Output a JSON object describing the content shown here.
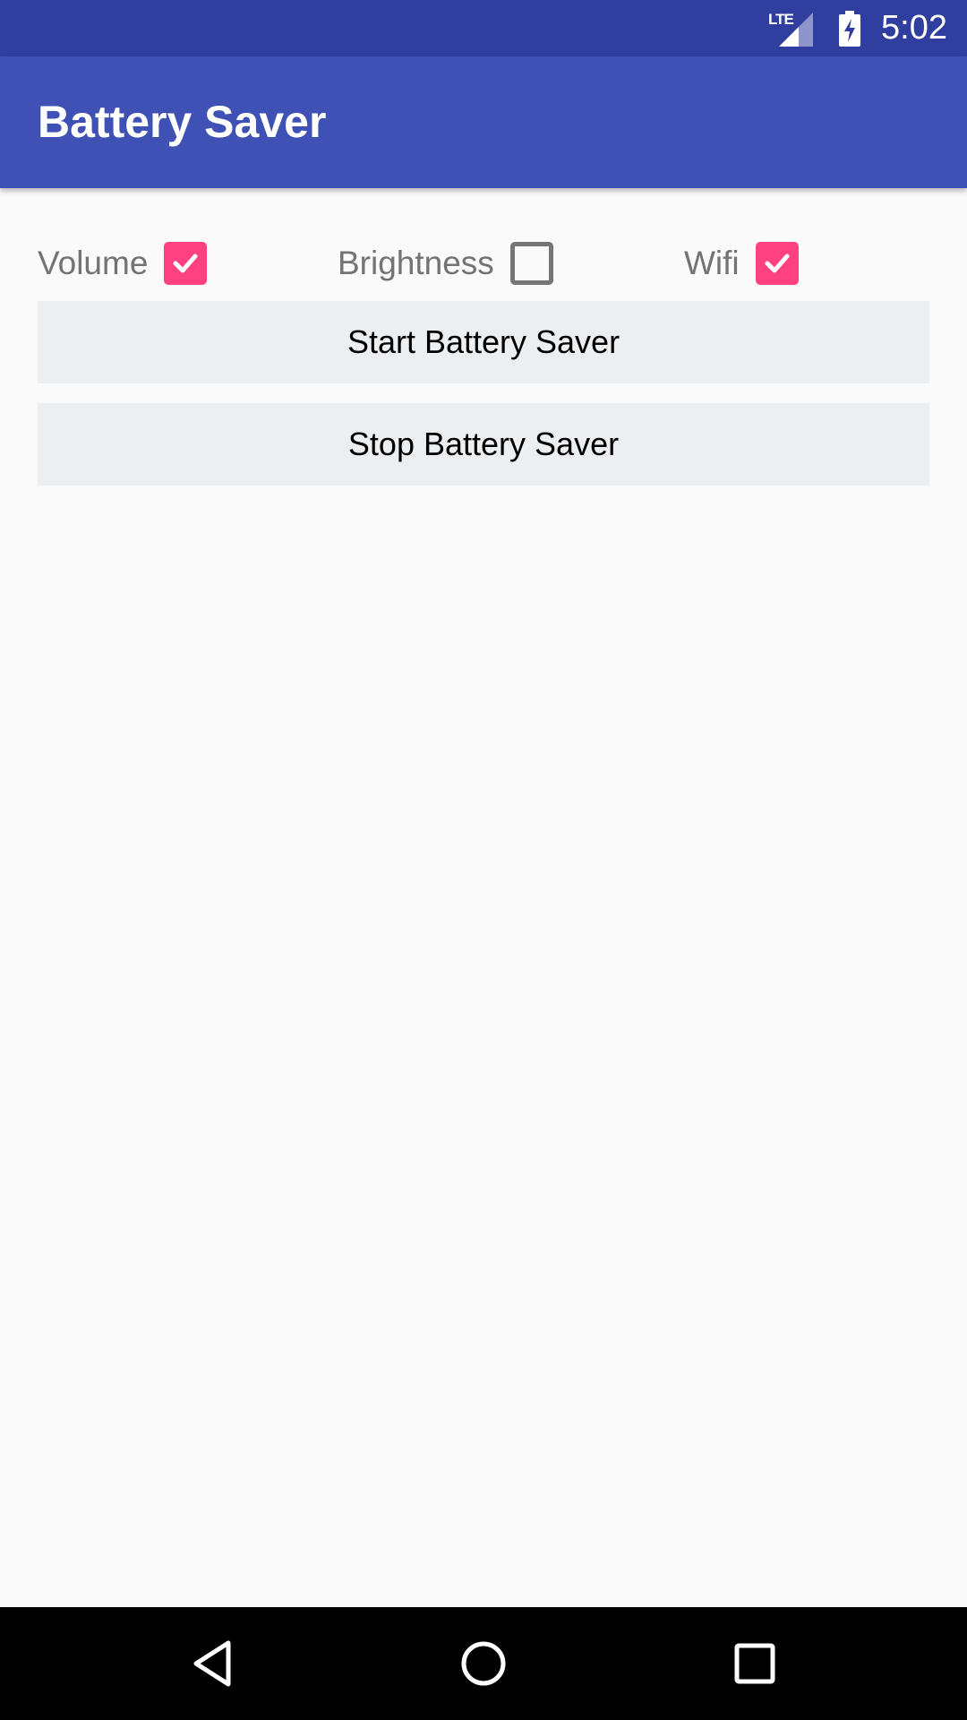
{
  "status_bar": {
    "network_label": "LTE",
    "time": "5:02",
    "icons": [
      "signal-icon",
      "battery-charging-icon"
    ]
  },
  "app_bar": {
    "title": "Battery Saver"
  },
  "options": [
    {
      "label": "Volume",
      "checked": true
    },
    {
      "label": "Brightness",
      "checked": false
    },
    {
      "label": "Wifi",
      "checked": true
    }
  ],
  "buttons": {
    "start": "Start Battery Saver",
    "stop": "Stop Battery Saver"
  },
  "nav_bar": {
    "icons": [
      "back-icon",
      "home-icon",
      "recents-icon"
    ]
  },
  "colors": {
    "status_bar": "#303f9f",
    "app_bar": "#3f51b5",
    "accent": "#ff4081",
    "button_bg": "#eceff1",
    "background": "#fafafa"
  }
}
